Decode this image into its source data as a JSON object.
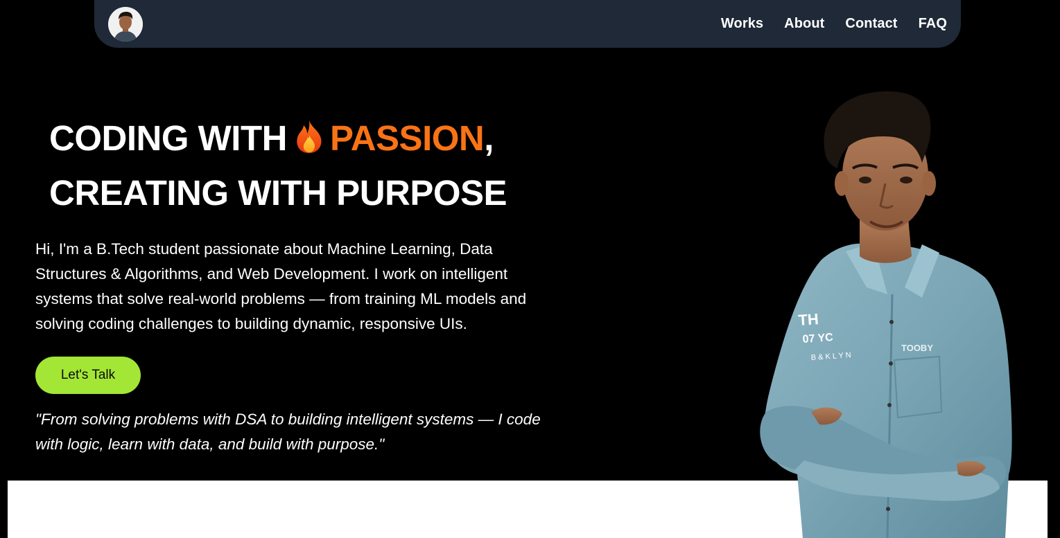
{
  "nav": {
    "links": [
      "Works",
      "About",
      "Contact",
      "FAQ"
    ]
  },
  "hero": {
    "headline_part1": "CODING WITH",
    "headline_accent": "PASSION",
    "headline_comma": ",",
    "headline_line2": "CREATING WITH PURPOSE",
    "intro": "Hi, I'm a B.Tech student passionate about Machine Learning, Data Structures & Algorithms, and Web Development. I work on intelligent systems that solve real-world problems — from training ML models and solving coding challenges to building dynamic, responsive UIs.",
    "cta_label": "Let's Talk",
    "quote": "\"From solving problems with DSA to building intelligent systems — I code with logic, learn with data, and build with purpose.\""
  },
  "colors": {
    "background": "#000000",
    "navbar": "#1f2937",
    "accent": "#f97316",
    "cta": "#a3e635",
    "text": "#ffffff"
  },
  "icons": {
    "fire": "fire-icon",
    "avatar": "profile-avatar",
    "portrait": "profile-photo"
  }
}
